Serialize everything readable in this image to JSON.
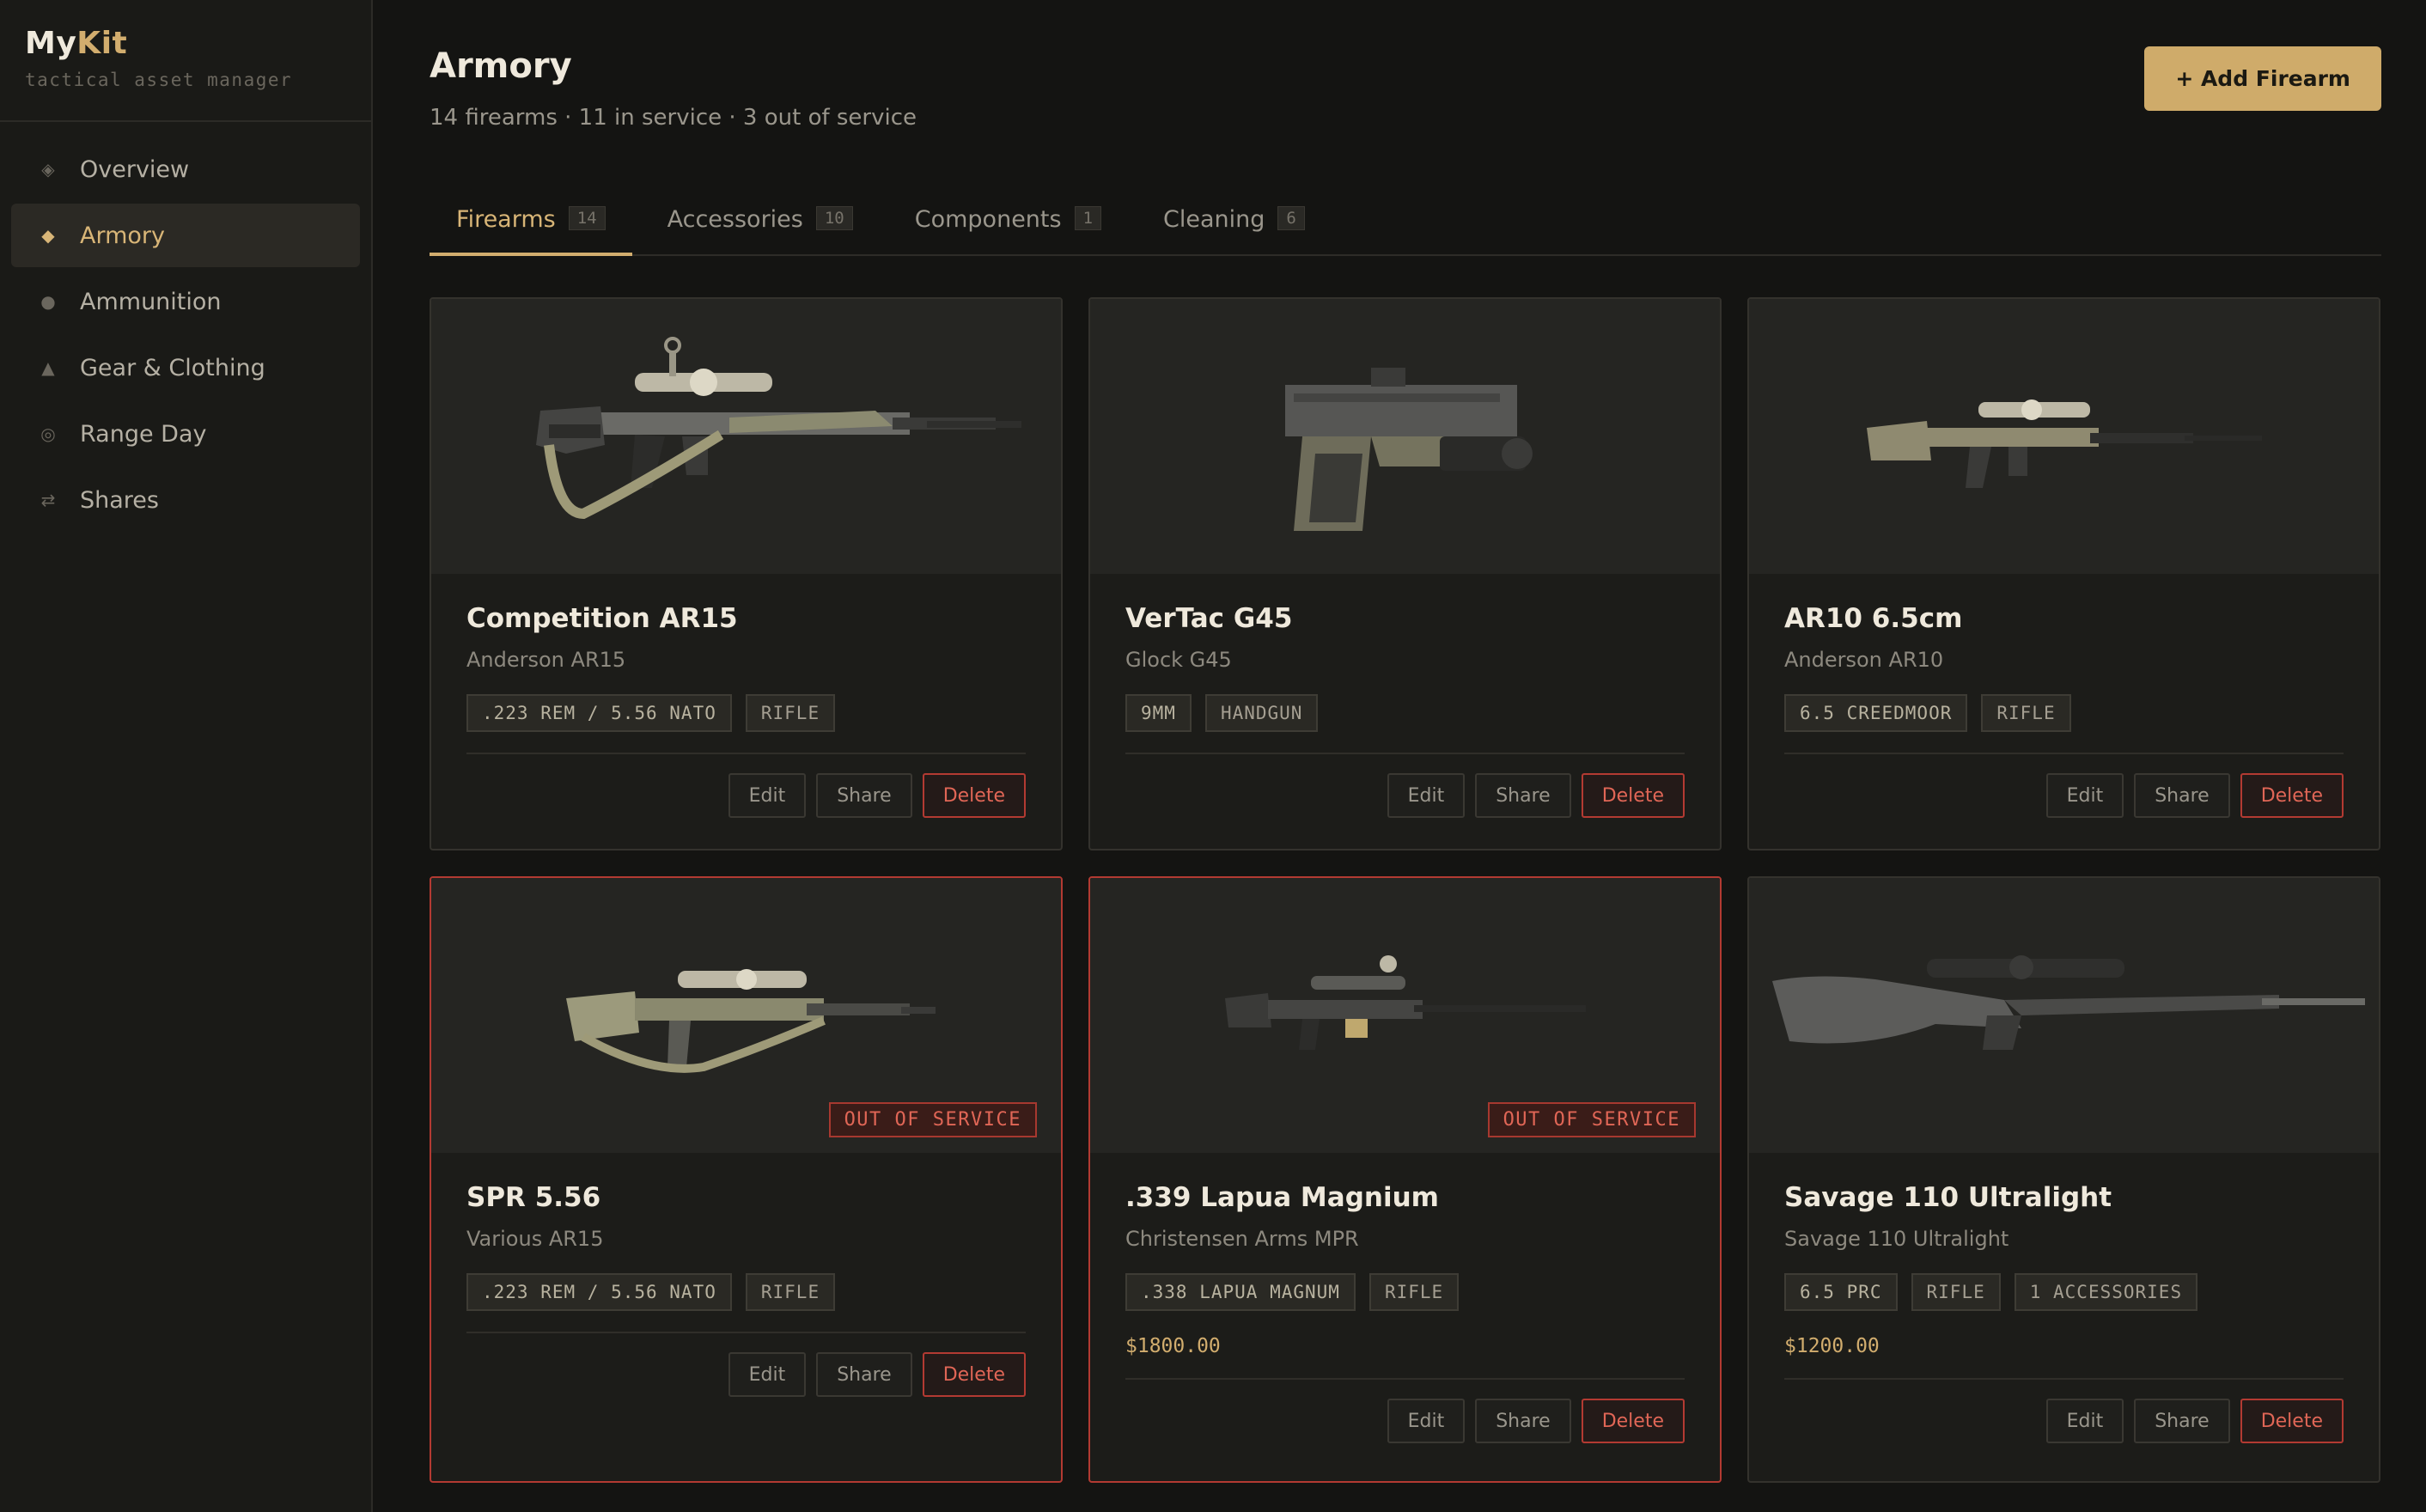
{
  "brand": {
    "name_a": "My",
    "name_b": "Kit",
    "tagline": "tactical asset manager"
  },
  "nav": [
    {
      "label": "Overview",
      "icon": "◈",
      "icon_name": "diamond-icon"
    },
    {
      "label": "Armory",
      "icon": "◆",
      "icon_name": "armory-icon",
      "active": true
    },
    {
      "label": "Ammunition",
      "icon": "●",
      "icon_name": "ammunition-icon"
    },
    {
      "label": "Gear & Clothing",
      "icon": "▲",
      "icon_name": "gear-icon"
    },
    {
      "label": "Range Day",
      "icon": "◎",
      "icon_name": "target-icon"
    },
    {
      "label": "Shares",
      "icon": "⇄",
      "icon_name": "share-icon"
    }
  ],
  "header": {
    "title": "Armory",
    "subtitle": "14 firearms · 11 in service · 3 out of service",
    "add_label": "+ Add Firearm"
  },
  "tabs": [
    {
      "label": "Firearms",
      "count": "14",
      "active": true
    },
    {
      "label": "Accessories",
      "count": "10"
    },
    {
      "label": "Components",
      "count": "1"
    },
    {
      "label": "Cleaning",
      "count": "6"
    }
  ],
  "colors": {
    "accent": "#d2ad6e",
    "danger": "#e06656",
    "background": "#141412"
  },
  "actions": {
    "edit": "Edit",
    "share": "Share",
    "delete": "Delete"
  },
  "oos_label": "OUT OF SERVICE",
  "cards": [
    {
      "name": "Competition AR15",
      "model": "Anderson AR15",
      "caliber": ".223 REM / 5.56 NATO",
      "type": "RIFLE",
      "image": "ar15-rifle-image"
    },
    {
      "name": "VerTac G45",
      "model": "Glock G45",
      "caliber": "9MM",
      "type": "HANDGUN",
      "image": "pistol-image"
    },
    {
      "name": "AR10 6.5cm",
      "model": "Anderson AR10",
      "caliber": "6.5 CREEDMOOR",
      "type": "RIFLE",
      "image": "ar10-rifle-image"
    },
    {
      "name": "SPR 5.56",
      "model": "Various AR15",
      "caliber": ".223 REM / 5.56 NATO",
      "type": "RIFLE",
      "image": "spr-rifle-image",
      "out_of_service": true
    },
    {
      "name": ".339 Lapua Magnium",
      "model": "Christensen Arms MPR",
      "caliber": ".338 LAPUA MAGNUM",
      "type": "RIFLE",
      "price": "$1800.00",
      "image": "precision-rifle-image",
      "out_of_service": true
    },
    {
      "name": "Savage 110 Ultralight",
      "model": "Savage 110 Ultralight",
      "caliber": "6.5 PRC",
      "type": "RIFLE",
      "extra": "1 ACCESSORIES",
      "price": "$1200.00",
      "image": "bolt-rifle-image"
    }
  ]
}
